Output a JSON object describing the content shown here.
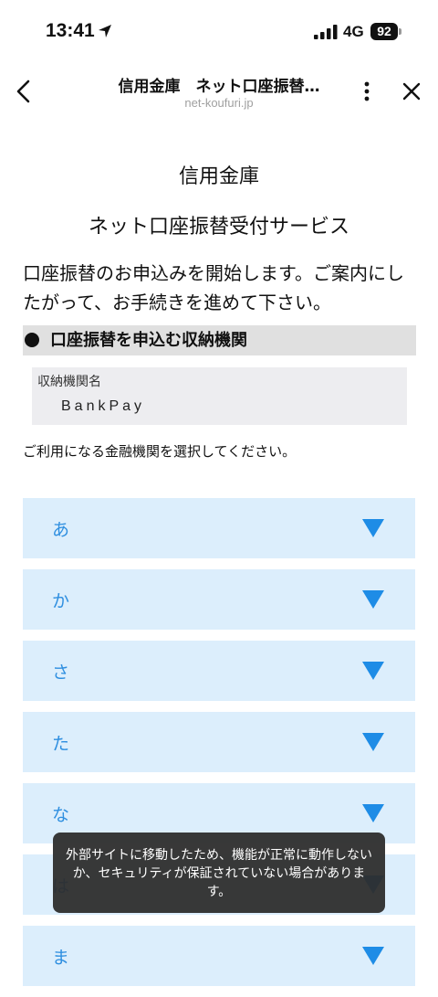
{
  "status_bar": {
    "time": "13:41",
    "network": "4G",
    "battery": "92"
  },
  "nav": {
    "title": "信用金庫　ネット口座振替…",
    "subtitle": "net-koufuri.jp"
  },
  "page": {
    "org_name": "信用金庫",
    "service_title": "ネット口座振替受付サービス",
    "intro": "口座振替のお申込みを開始します。ご案内にしたがって、お手続きを進めて下さい。",
    "section_heading": "口座振替を申込む収納機関",
    "institution": {
      "label": "収納機関名",
      "value": "BankPay"
    },
    "choose_prompt": "ご利用になる金融機関を選択してください。",
    "kana_groups": [
      {
        "label": "あ"
      },
      {
        "label": "か"
      },
      {
        "label": "さ"
      },
      {
        "label": "た"
      },
      {
        "label": "な"
      },
      {
        "label": "は"
      },
      {
        "label": "ま"
      }
    ]
  },
  "toast": {
    "message": "外部サイトに移動したため、機能が正常に動作しないか、セキュリティが保証されていない場合があります。"
  },
  "colors": {
    "accent": "#1e8ce6",
    "row_bg": "#dceefc",
    "kana_text": "#2f8fe0"
  }
}
